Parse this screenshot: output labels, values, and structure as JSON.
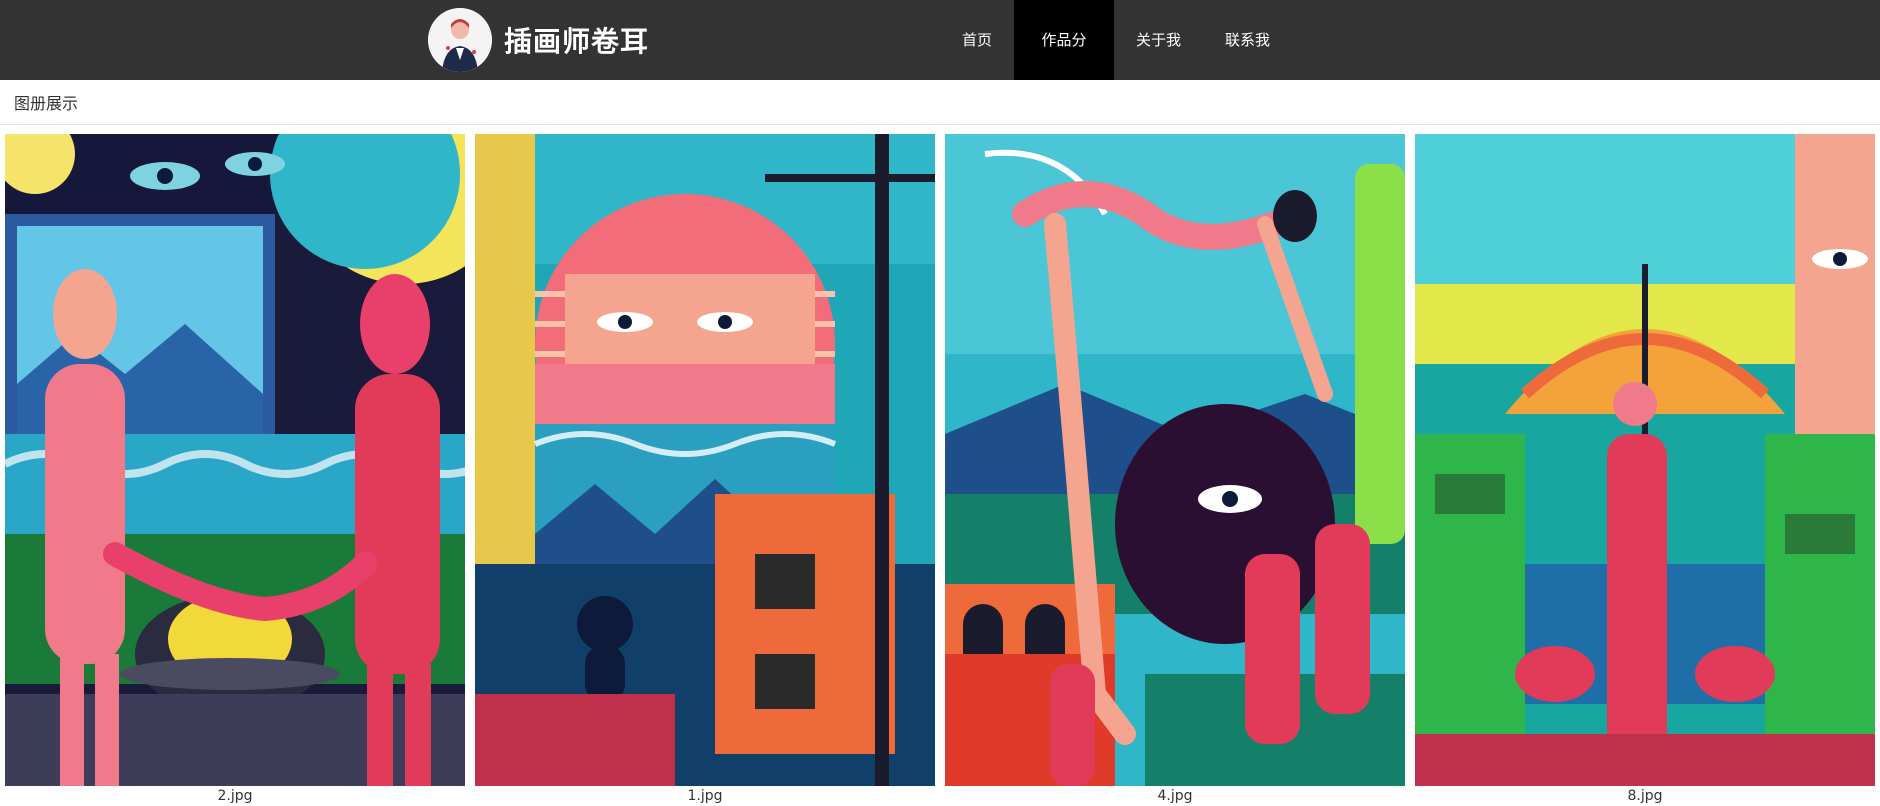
{
  "header": {
    "brand_title": "插画师卷耳",
    "nav": [
      {
        "label": "首页",
        "active": false
      },
      {
        "label": "作品分类",
        "active": true
      },
      {
        "label": "关于我",
        "active": false
      },
      {
        "label": "联系我",
        "active": false
      }
    ]
  },
  "section": {
    "title": "图册展示"
  },
  "gallery": [
    {
      "caption": "2.jpg"
    },
    {
      "caption": "1.jpg"
    },
    {
      "caption": "4.jpg"
    },
    {
      "caption": "8.jpg"
    }
  ]
}
